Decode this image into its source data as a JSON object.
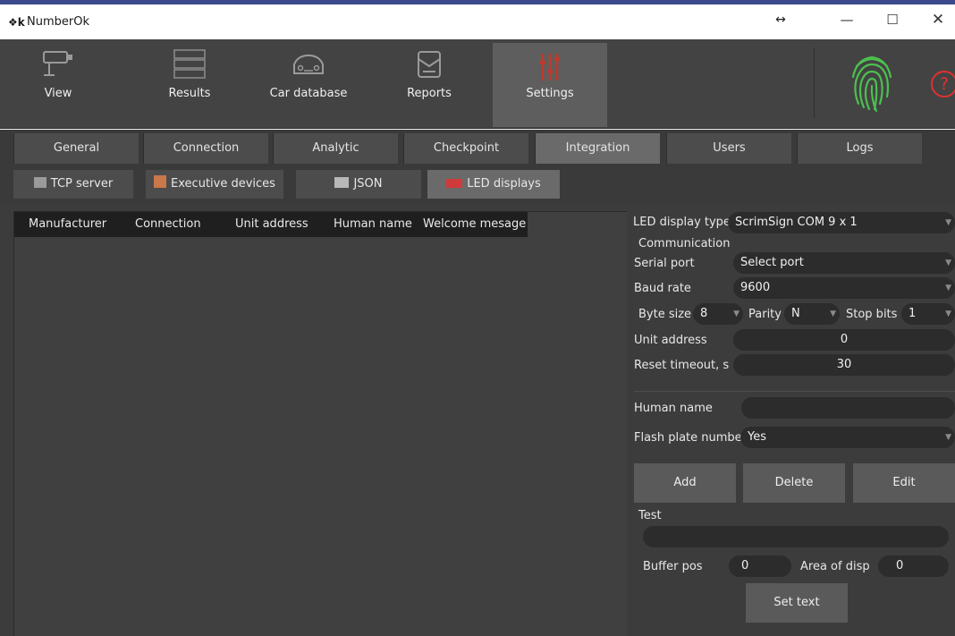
{
  "window": {
    "title": "NumberOk",
    "icon_text": "❖k"
  },
  "toolbar": {
    "items": [
      {
        "label": "View",
        "icon": "camera-icon"
      },
      {
        "label": "Results",
        "icon": "results-list-icon"
      },
      {
        "label": "Car database",
        "icon": "car-icon"
      },
      {
        "label": "Reports",
        "icon": "reports-icon"
      },
      {
        "label": "Settings",
        "icon": "settings-sliders-icon",
        "active": true
      }
    ],
    "help_label": "?"
  },
  "tabs": [
    "General",
    "Connection",
    "Analytic",
    "Checkpoint",
    "Integration",
    "Users",
    "Logs"
  ],
  "active_tab": "Integration",
  "subtabs": [
    "TCP server",
    "Executive devices",
    "JSON",
    "LED displays"
  ],
  "active_subtab": "LED displays",
  "table": {
    "columns": [
      "Manufacturer",
      "Connection",
      "Unit address",
      "Human name",
      "Welcome mesage"
    ],
    "rows": []
  },
  "form": {
    "led_display_type_label": "LED display type",
    "led_display_type_value": "ScrimSign COM 9 x 1",
    "communication_label": "Communication",
    "serial_port_label": "Serial port",
    "serial_port_value": "Select port",
    "baud_rate_label": "Baud rate",
    "baud_rate_value": "9600",
    "byte_size_label": "Byte size",
    "byte_size_value": "8",
    "parity_label": "Parity",
    "parity_value": "N",
    "stop_bits_label": "Stop bits",
    "stop_bits_value": "1",
    "unit_address_label": "Unit address",
    "unit_address_value": "0",
    "reset_timeout_label": "Reset timeout, s",
    "reset_timeout_value": "30",
    "human_name_label": "Human name",
    "human_name_value": "",
    "flash_plate_label": "Flash plate number",
    "flash_plate_value": "Yes",
    "add_label": "Add",
    "delete_label": "Delete",
    "edit_label": "Edit",
    "test_label": "Test",
    "test_value": "",
    "buffer_pos_label": "Buffer pos",
    "buffer_pos_value": "0",
    "area_of_disp_label": "Area of disp",
    "area_of_disp_value": "0",
    "set_text_label": "Set text"
  },
  "colors": {
    "background": "#3c3c3c",
    "toolbar": "#434343",
    "active_tab": "#6a6a6a",
    "accent_red": "#e03030",
    "fingerprint_green": "#3fb34a"
  }
}
